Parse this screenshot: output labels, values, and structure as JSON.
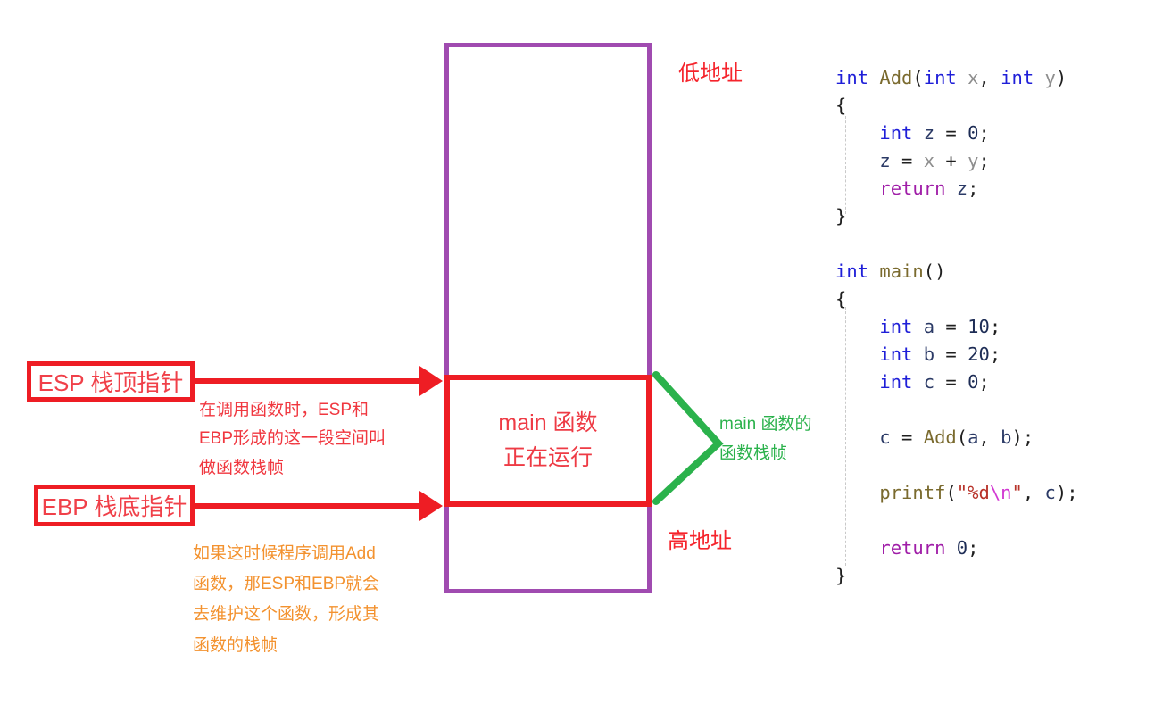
{
  "diagram": {
    "stack_column": {
      "name": "stack-memory-column",
      "border_color": "#a04bb0"
    },
    "main_frame": {
      "line1": "main 函数",
      "line2": "正在运行",
      "border_color": "#ee1d24",
      "text_color": "#ee3b45"
    },
    "pointers": {
      "esp_label": "ESP 栈顶指针",
      "ebp_label": "EBP 栈底指针",
      "color": "#ee1d24"
    },
    "notes": {
      "red_note_lines": [
        "在调用函数时，ESP和",
        "EBP形成的这一段空间叫",
        "做函数栈帧"
      ],
      "red_note_color": "#f0373f",
      "orange_note_lines": [
        "如果这时候程序调用Add",
        "函数，那ESP和EBP就会",
        "去维护这个函数，形成其",
        "函数的栈帧"
      ],
      "orange_note_color": "#f3922f"
    },
    "addresses": {
      "low": "低地址",
      "high": "高地址",
      "color": "#f5242c"
    },
    "green_brace": {
      "line1": "main 函数的",
      "line2": "函数栈帧",
      "color": "#2bb24c"
    }
  },
  "code": {
    "language": "c",
    "lines": [
      {
        "id": "add-signature",
        "tokens": [
          {
            "t": "int",
            "c": "kw"
          },
          {
            "t": " ",
            "c": "plain"
          },
          {
            "t": "Add",
            "c": "fn"
          },
          {
            "t": "(",
            "c": "plain"
          },
          {
            "t": "int",
            "c": "kw"
          },
          {
            "t": " ",
            "c": "plain"
          },
          {
            "t": "x",
            "c": "param"
          },
          {
            "t": ", ",
            "c": "plain"
          },
          {
            "t": "int",
            "c": "kw"
          },
          {
            "t": " ",
            "c": "plain"
          },
          {
            "t": "y",
            "c": "param"
          },
          {
            "t": ")",
            "c": "plain"
          }
        ]
      },
      {
        "id": "add-open-brace",
        "tokens": [
          {
            "t": "{",
            "c": "plain"
          }
        ]
      },
      {
        "id": "add-decl-z",
        "tokens": [
          {
            "t": "    ",
            "c": "plain"
          },
          {
            "t": "int",
            "c": "kw"
          },
          {
            "t": " ",
            "c": "plain"
          },
          {
            "t": "z",
            "c": "var"
          },
          {
            "t": " = ",
            "c": "plain"
          },
          {
            "t": "0",
            "c": "num"
          },
          {
            "t": ";",
            "c": "plain"
          }
        ]
      },
      {
        "id": "add-assign-z",
        "tokens": [
          {
            "t": "    ",
            "c": "plain"
          },
          {
            "t": "z",
            "c": "var"
          },
          {
            "t": " = ",
            "c": "plain"
          },
          {
            "t": "x",
            "c": "param"
          },
          {
            "t": " + ",
            "c": "plain"
          },
          {
            "t": "y",
            "c": "param"
          },
          {
            "t": ";",
            "c": "plain"
          }
        ]
      },
      {
        "id": "add-return-z",
        "tokens": [
          {
            "t": "    ",
            "c": "plain"
          },
          {
            "t": "return",
            "c": "ret"
          },
          {
            "t": " ",
            "c": "plain"
          },
          {
            "t": "z",
            "c": "var"
          },
          {
            "t": ";",
            "c": "plain"
          }
        ]
      },
      {
        "id": "add-close-brace",
        "tokens": [
          {
            "t": "}",
            "c": "plain"
          }
        ]
      },
      {
        "id": "blank-1",
        "tokens": [
          {
            "t": " ",
            "c": "plain"
          }
        ]
      },
      {
        "id": "main-signature",
        "tokens": [
          {
            "t": "int",
            "c": "kw"
          },
          {
            "t": " ",
            "c": "plain"
          },
          {
            "t": "main",
            "c": "fn"
          },
          {
            "t": "()",
            "c": "plain"
          }
        ]
      },
      {
        "id": "main-open-brace",
        "tokens": [
          {
            "t": "{",
            "c": "plain"
          }
        ]
      },
      {
        "id": "main-decl-a",
        "tokens": [
          {
            "t": "    ",
            "c": "plain"
          },
          {
            "t": "int",
            "c": "kw"
          },
          {
            "t": " ",
            "c": "plain"
          },
          {
            "t": "a",
            "c": "var"
          },
          {
            "t": " = ",
            "c": "plain"
          },
          {
            "t": "10",
            "c": "num"
          },
          {
            "t": ";",
            "c": "plain"
          }
        ]
      },
      {
        "id": "main-decl-b",
        "tokens": [
          {
            "t": "    ",
            "c": "plain"
          },
          {
            "t": "int",
            "c": "kw"
          },
          {
            "t": " ",
            "c": "plain"
          },
          {
            "t": "b",
            "c": "var"
          },
          {
            "t": " = ",
            "c": "plain"
          },
          {
            "t": "20",
            "c": "num"
          },
          {
            "t": ";",
            "c": "plain"
          }
        ]
      },
      {
        "id": "main-decl-c",
        "tokens": [
          {
            "t": "    ",
            "c": "plain"
          },
          {
            "t": "int",
            "c": "kw"
          },
          {
            "t": " ",
            "c": "plain"
          },
          {
            "t": "c",
            "c": "var"
          },
          {
            "t": " = ",
            "c": "plain"
          },
          {
            "t": "0",
            "c": "num"
          },
          {
            "t": ";",
            "c": "plain"
          }
        ]
      },
      {
        "id": "blank-2",
        "tokens": [
          {
            "t": " ",
            "c": "plain"
          }
        ]
      },
      {
        "id": "main-call-add",
        "tokens": [
          {
            "t": "    ",
            "c": "plain"
          },
          {
            "t": "c",
            "c": "var"
          },
          {
            "t": " = ",
            "c": "plain"
          },
          {
            "t": "Add",
            "c": "fn"
          },
          {
            "t": "(",
            "c": "plain"
          },
          {
            "t": "a",
            "c": "var"
          },
          {
            "t": ", ",
            "c": "plain"
          },
          {
            "t": "b",
            "c": "var"
          },
          {
            "t": ");",
            "c": "plain"
          }
        ]
      },
      {
        "id": "blank-3",
        "tokens": [
          {
            "t": " ",
            "c": "plain"
          }
        ]
      },
      {
        "id": "main-printf",
        "tokens": [
          {
            "t": "    ",
            "c": "plain"
          },
          {
            "t": "printf",
            "c": "fn"
          },
          {
            "t": "(",
            "c": "plain"
          },
          {
            "t": "\"%d",
            "c": "str"
          },
          {
            "t": "\\n",
            "c": "esc"
          },
          {
            "t": "\"",
            "c": "str"
          },
          {
            "t": ", ",
            "c": "plain"
          },
          {
            "t": "c",
            "c": "var"
          },
          {
            "t": ");",
            "c": "plain"
          }
        ]
      },
      {
        "id": "blank-4",
        "tokens": [
          {
            "t": " ",
            "c": "plain"
          }
        ]
      },
      {
        "id": "main-return-0",
        "tokens": [
          {
            "t": "    ",
            "c": "plain"
          },
          {
            "t": "return",
            "c": "ret"
          },
          {
            "t": " ",
            "c": "plain"
          },
          {
            "t": "0",
            "c": "num"
          },
          {
            "t": ";",
            "c": "plain"
          }
        ]
      },
      {
        "id": "main-close-brace",
        "tokens": [
          {
            "t": "}",
            "c": "plain"
          }
        ]
      }
    ]
  }
}
